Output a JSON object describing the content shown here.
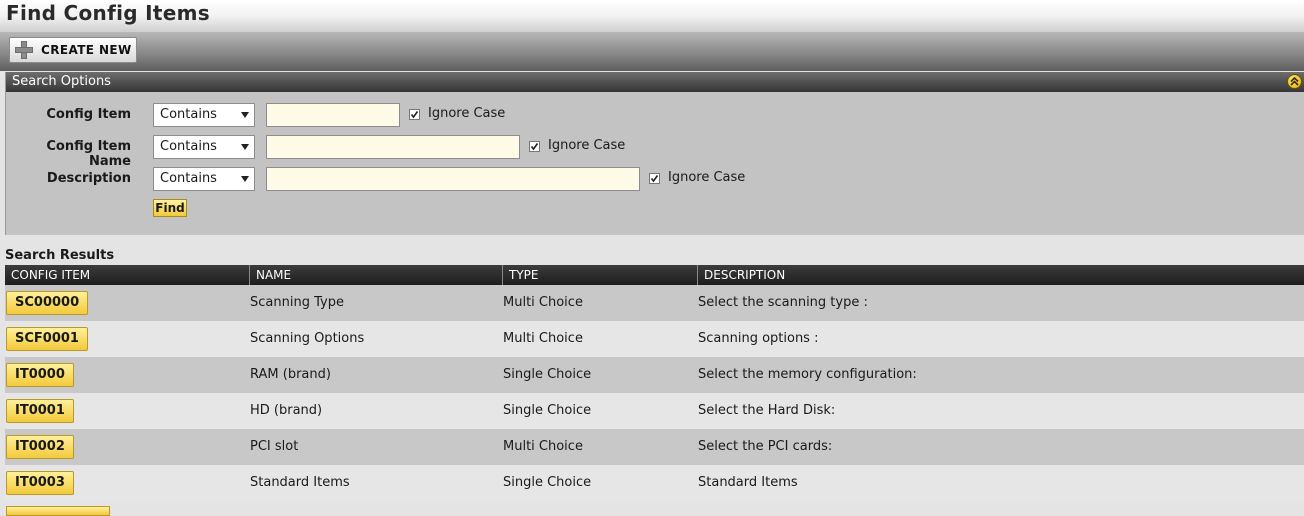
{
  "page": {
    "title": "Find Config Items"
  },
  "toolbar": {
    "create_label": "CREATE NEW"
  },
  "search": {
    "header": "Search Options",
    "rows": [
      {
        "label": "Config Item",
        "operator": "Contains",
        "value": "",
        "ignore_case_label": "Ignore Case",
        "ignore_case": true
      },
      {
        "label": "Config Item Name",
        "operator": "Contains",
        "value": "",
        "ignore_case_label": "Ignore Case",
        "ignore_case": true
      },
      {
        "label": "Description",
        "operator": "Contains",
        "value": "",
        "ignore_case_label": "Ignore Case",
        "ignore_case": true
      }
    ],
    "find_label": "Find"
  },
  "results": {
    "title": "Search Results",
    "columns": [
      "CONFIG ITEM",
      "NAME",
      "TYPE",
      "DESCRIPTION"
    ],
    "rows": [
      {
        "id": "SC00000",
        "name": "Scanning Type",
        "type": "Multi Choice",
        "description": "Select the scanning type :"
      },
      {
        "id": "SCF0001",
        "name": "Scanning Options",
        "type": "Multi Choice",
        "description": "Scanning options :"
      },
      {
        "id": "IT0000",
        "name": "RAM (brand)",
        "type": "Single Choice",
        "description": "Select the memory configuration:"
      },
      {
        "id": "IT0001",
        "name": "HD (brand)",
        "type": "Single Choice",
        "description": "Select the Hard Disk:"
      },
      {
        "id": "IT0002",
        "name": "PCI slot",
        "type": "Multi Choice",
        "description": "Select the PCI cards:"
      },
      {
        "id": "IT0003",
        "name": "Standard Items",
        "type": "Single Choice",
        "description": "Standard Items"
      }
    ]
  },
  "colors": {
    "accent_yellow": "#f3c93b",
    "header_dark": "#2a2a2a",
    "input_bg": "#fdfbe8"
  }
}
